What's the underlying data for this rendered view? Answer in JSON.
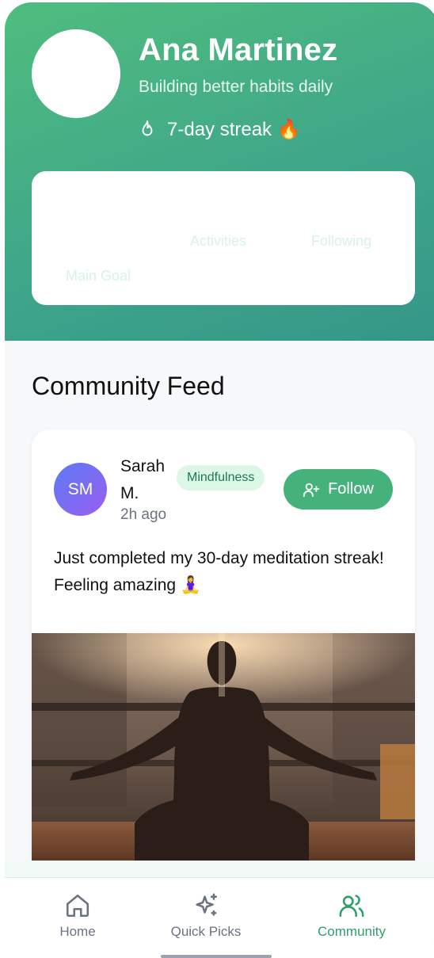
{
  "profile": {
    "name": "Ana Martinez",
    "tagline": "Building better habits daily",
    "streak": "7-day streak 🔥",
    "streak_icon": "flame-icon"
  },
  "stats": {
    "activities_label": "Activities",
    "following_label": "Following",
    "main_goal_label": "Main Goal"
  },
  "feed": {
    "title": "Community Feed",
    "posts": [
      {
        "avatar_initials": "SM",
        "author": "Sarah M.",
        "time": "2h ago",
        "tag": "Mindfulness",
        "follow_label": "Follow",
        "text": "Just completed my 30-day meditation streak! Feeling amazing 🧘‍♀️"
      }
    ]
  },
  "nav": {
    "items": [
      {
        "label": "Home",
        "icon": "home-icon"
      },
      {
        "label": "Quick Picks",
        "icon": "sparkles-icon"
      },
      {
        "label": "Community",
        "icon": "users-icon",
        "active": true
      }
    ]
  },
  "colors": {
    "brand_green": "#45b27c",
    "active_nav": "#2f9e6a"
  }
}
